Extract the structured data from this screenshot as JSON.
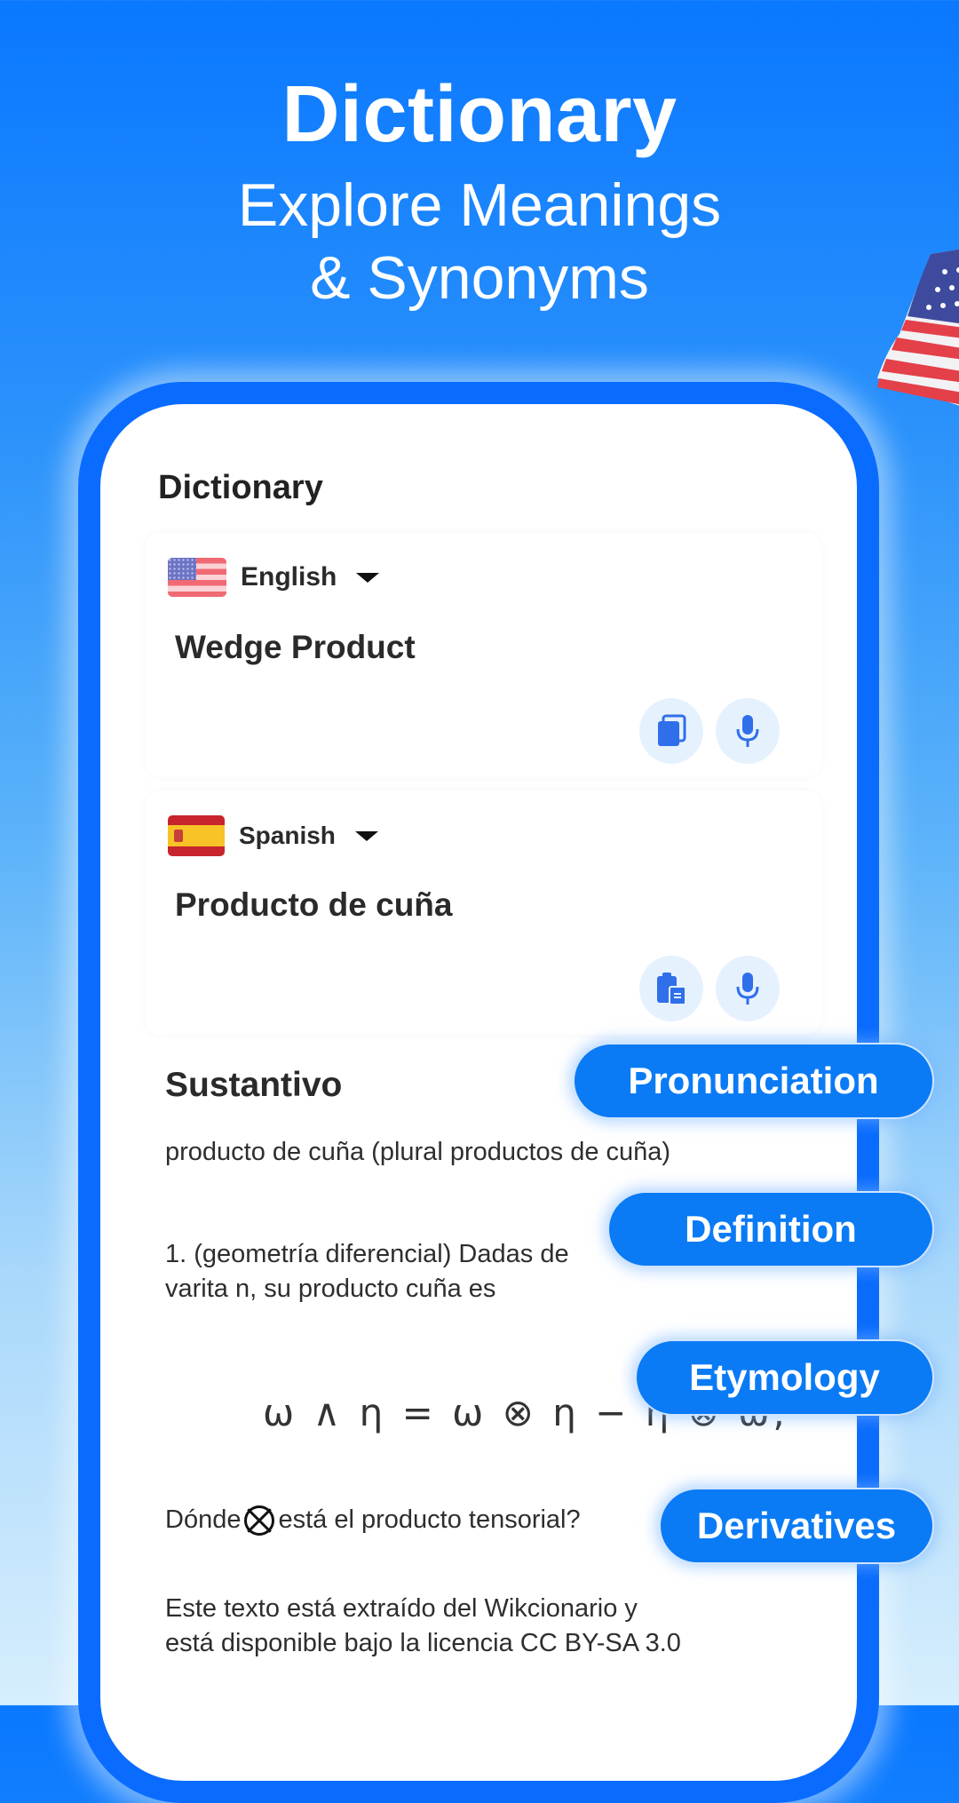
{
  "hero": {
    "title": "Dictionary",
    "subtitle_line1": "Explore Meanings",
    "subtitle_line2": "& Synonyms"
  },
  "colors": {
    "accent": "#0A6CFF",
    "pill": "#0A7BF5",
    "icon_button_bg": "#E6F1FE",
    "icon": "#2F6FEA"
  },
  "app": {
    "title": "Dictionary",
    "source": {
      "language": "English",
      "flag": "us-flag",
      "text": "Wedge Product",
      "actions": [
        {
          "icon": "copy-icon"
        },
        {
          "icon": "microphone-icon"
        }
      ]
    },
    "target": {
      "language": "Spanish",
      "flag": "spain-flag",
      "text": "Producto de cuña",
      "actions": [
        {
          "icon": "paste-icon"
        },
        {
          "icon": "microphone-icon"
        }
      ]
    },
    "entry": {
      "part_of_speech": "Sustantivo",
      "plural": "producto de cuña (plural productos de cuña)",
      "definition_line1": "1. (geometría diferencial) Dadas de",
      "definition_line2": "varita n, su producto cuña es",
      "formula": "ω ∧ η = ω ⊗ η − η ⊗ ω,",
      "tensor_prefix": "Dónde",
      "tensor_suffix": "está el producto tensorial?",
      "license_line1": "Este texto está extraído del Wikcionario y",
      "license_line2": "está disponible bajo la licencia CC BY-SA 3.0"
    }
  },
  "features": [
    {
      "label": "Pronunciation"
    },
    {
      "label": "Definition"
    },
    {
      "label": "Etymology"
    },
    {
      "label": "Derivatives"
    }
  ]
}
